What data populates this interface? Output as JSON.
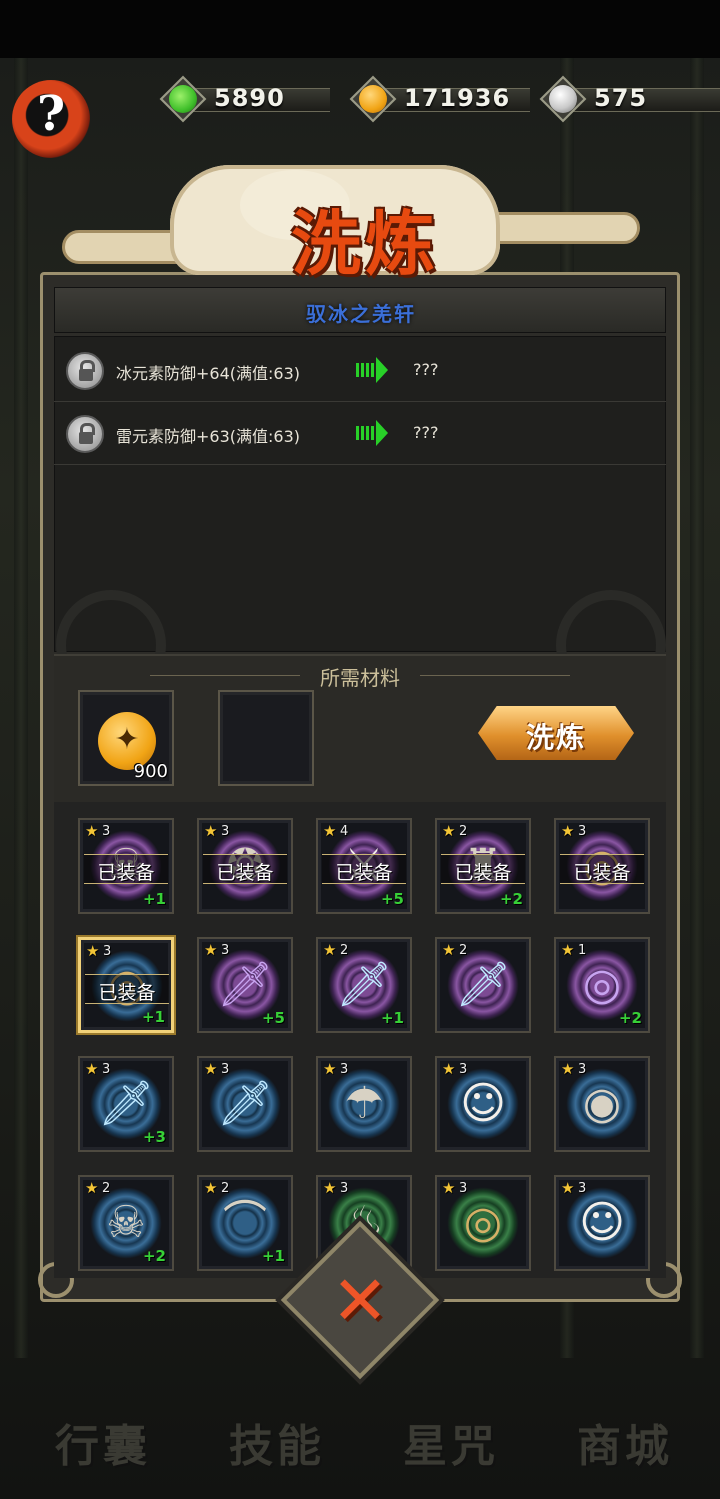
{
  "currencies": [
    {
      "name": "jade-icon",
      "value": "5890",
      "color": "#3fbf2a"
    },
    {
      "name": "gold-coin-icon",
      "value": "171936",
      "color": "#f1a415"
    },
    {
      "name": "silver-spiral-icon",
      "value": "575",
      "color": "#c9c9c9"
    }
  ],
  "help": {
    "label": "?"
  },
  "title": "洗炼",
  "equipment_name": "驭冰之羌轩",
  "attributes": [
    {
      "current": "冰元素防御+64(满值:63)",
      "next": "???"
    },
    {
      "current": "雷元素防御+63(满值:63)",
      "next": "???"
    }
  ],
  "materials": {
    "label": "所需材料",
    "slots": [
      {
        "icon": "gold-coin-icon",
        "quantity": "900"
      },
      {
        "icon": "",
        "quantity": ""
      }
    ]
  },
  "refine_button": "洗炼",
  "equipped_label": "已装备",
  "items": [
    {
      "stars": "3",
      "plus": "+1",
      "equipped": true,
      "halo": "purple",
      "icon": "skull-mask-icon",
      "glyph": "☠"
    },
    {
      "stars": "3",
      "plus": "",
      "equipped": true,
      "halo": "purple",
      "icon": "amulet-icon",
      "glyph": "❂"
    },
    {
      "stars": "4",
      "plus": "+5",
      "equipped": true,
      "halo": "purple",
      "icon": "red-blade-icon",
      "glyph": "⚔"
    },
    {
      "stars": "2",
      "plus": "+2",
      "equipped": true,
      "halo": "purple",
      "icon": "blue-robe-icon",
      "glyph": "♜"
    },
    {
      "stars": "3",
      "plus": "",
      "equipped": true,
      "halo": "purple",
      "icon": "gold-ring-icon",
      "glyph": "◎"
    },
    {
      "stars": "3",
      "plus": "+1",
      "equipped": true,
      "halo": "blue",
      "icon": "band-icon",
      "glyph": "◎",
      "selected": true
    },
    {
      "stars": "3",
      "plus": "+5",
      "equipped": false,
      "halo": "purple",
      "icon": "purple-blade-icon",
      "glyph": "🗡"
    },
    {
      "stars": "2",
      "plus": "+1",
      "equipped": false,
      "halo": "purple",
      "icon": "ice-sword-icon",
      "glyph": "🗡"
    },
    {
      "stars": "2",
      "plus": "",
      "equipped": false,
      "halo": "purple",
      "icon": "ice-sword-icon",
      "glyph": "🗡"
    },
    {
      "stars": "1",
      "plus": "+2",
      "equipped": false,
      "halo": "purple",
      "icon": "purple-ring-icon",
      "glyph": "◎"
    },
    {
      "stars": "3",
      "plus": "+3",
      "equipped": false,
      "halo": "blue",
      "icon": "jade-sword-icon",
      "glyph": "🗡"
    },
    {
      "stars": "3",
      "plus": "",
      "equipped": false,
      "halo": "blue",
      "icon": "jade-sword-icon",
      "glyph": "🗡"
    },
    {
      "stars": "3",
      "plus": "",
      "equipped": false,
      "halo": "blue",
      "icon": "hat-icon",
      "glyph": "☂"
    },
    {
      "stars": "3",
      "plus": "",
      "equipped": false,
      "halo": "blue",
      "icon": "fox-mask-icon",
      "glyph": "☺"
    },
    {
      "stars": "3",
      "plus": "",
      "equipped": false,
      "halo": "blue",
      "icon": "orb-necklace-icon",
      "glyph": "◉"
    },
    {
      "stars": "2",
      "plus": "+2",
      "equipped": false,
      "halo": "blue",
      "icon": "skull-mask-icon",
      "glyph": "☠"
    },
    {
      "stars": "2",
      "plus": "+1",
      "equipped": false,
      "halo": "blue",
      "icon": "fang-necklace-icon",
      "glyph": "⌒"
    },
    {
      "stars": "3",
      "plus": "",
      "equipped": false,
      "halo": "green",
      "icon": "pouch-icon",
      "glyph": "♨"
    },
    {
      "stars": "3",
      "plus": "",
      "equipped": false,
      "halo": "green",
      "icon": "bronze-ring-icon",
      "glyph": "◎"
    },
    {
      "stars": "3",
      "plus": "",
      "equipped": false,
      "halo": "blue",
      "icon": "fox-mask-icon",
      "glyph": "☺"
    }
  ],
  "close_button": "✕",
  "nav": [
    {
      "label": "行囊"
    },
    {
      "label": "技能"
    },
    {
      "label": "星咒"
    },
    {
      "label": "商城"
    }
  ]
}
